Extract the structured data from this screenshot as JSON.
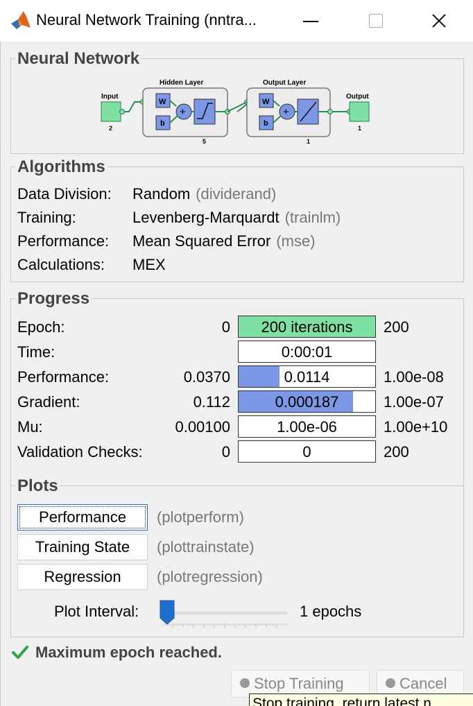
{
  "window": {
    "title": "Neural Network Training (nntra...",
    "app_icon": "matlab-logo-icon",
    "controls": [
      "minimize-icon",
      "maximize-icon",
      "close-icon"
    ]
  },
  "neural_network": {
    "heading": "Neural Network",
    "input_label": "Input",
    "input_size": "2",
    "hidden_label": "Hidden Layer",
    "hidden_size": "5",
    "output_layer_label": "Output Layer",
    "output_layer_size": "1",
    "output_label": "Output",
    "output_size": "1",
    "weight_symbol": "W",
    "bias_symbol": "b",
    "sum_symbol": "+"
  },
  "algorithms": {
    "heading": "Algorithms",
    "rows": [
      {
        "label": "Data Division:",
        "value": "Random",
        "fn": "(dividerand)"
      },
      {
        "label": "Training:",
        "value": "Levenberg-Marquardt",
        "fn": "(trainlm)"
      },
      {
        "label": "Performance:",
        "value": "Mean Squared Error",
        "fn": "(mse)"
      },
      {
        "label": "Calculations:",
        "value": "MEX",
        "fn": ""
      }
    ]
  },
  "progress": {
    "heading": "Progress",
    "rows": [
      {
        "label": "Epoch:",
        "start": "0",
        "value": "200 iterations",
        "end": "200",
        "fill": 1.0,
        "fill_color": "#7ee0a3"
      },
      {
        "label": "Time:",
        "start": "",
        "value": "0:00:01",
        "end": "",
        "fill": 0,
        "fill_color": "#ffffff"
      },
      {
        "label": "Performance:",
        "start": "0.0370",
        "value": "0.0114",
        "end": "1.00e-08",
        "fill": 0.3,
        "fill_color": "#7b97e6"
      },
      {
        "label": "Gradient:",
        "start": "0.112",
        "value": "0.000187",
        "end": "1.00e-07",
        "fill": 0.84,
        "fill_color": "#7b97e6"
      },
      {
        "label": "Mu:",
        "start": "0.00100",
        "value": "1.00e-06",
        "end": "1.00e+10",
        "fill": 0,
        "fill_color": "#7b97e6"
      },
      {
        "label": "Validation Checks:",
        "start": "0",
        "value": "0",
        "end": "200",
        "fill": 0,
        "fill_color": "#7b97e6"
      }
    ]
  },
  "plots": {
    "heading": "Plots",
    "buttons": [
      {
        "label": "Performance",
        "fn": "(plotperform)"
      },
      {
        "label": "Training State",
        "fn": "(plottrainstate)"
      },
      {
        "label": "Regression",
        "fn": "(plotregression)"
      }
    ],
    "interval_label": "Plot Interval:",
    "interval_value": "1 epochs",
    "interval_level": 0.0
  },
  "status": {
    "icon": "checkmark-icon",
    "text": "Maximum epoch reached."
  },
  "actions": {
    "stop_label": "Stop Training",
    "cancel_label": "Cancel"
  },
  "tooltip": {
    "text": "Stop training, return latest n"
  },
  "colors": {
    "accent_green": "#7ee0a3",
    "progress_blue": "#7b97e6",
    "layer_blue": "#7b97e6",
    "node_green": "#7ee0a3",
    "status_check": "#2aa44a"
  }
}
